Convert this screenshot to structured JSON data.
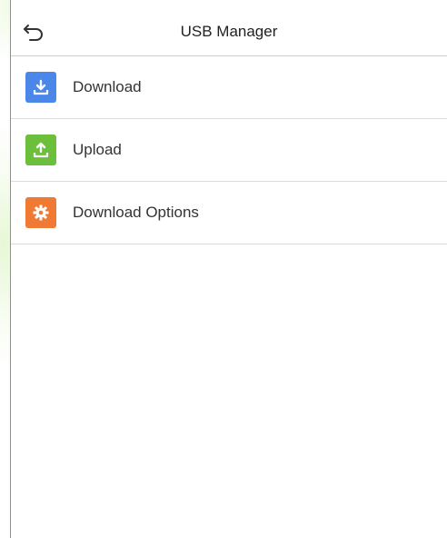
{
  "header": {
    "title": "USB Manager",
    "back_icon": "back-arrow-icon"
  },
  "menu": {
    "items": [
      {
        "label": "Download",
        "icon": "download-icon",
        "color": "#4a87e8"
      },
      {
        "label": "Upload",
        "icon": "upload-icon",
        "color": "#6cbf3a"
      },
      {
        "label": "Download Options",
        "icon": "gear-icon",
        "color": "#f07a34"
      }
    ]
  }
}
